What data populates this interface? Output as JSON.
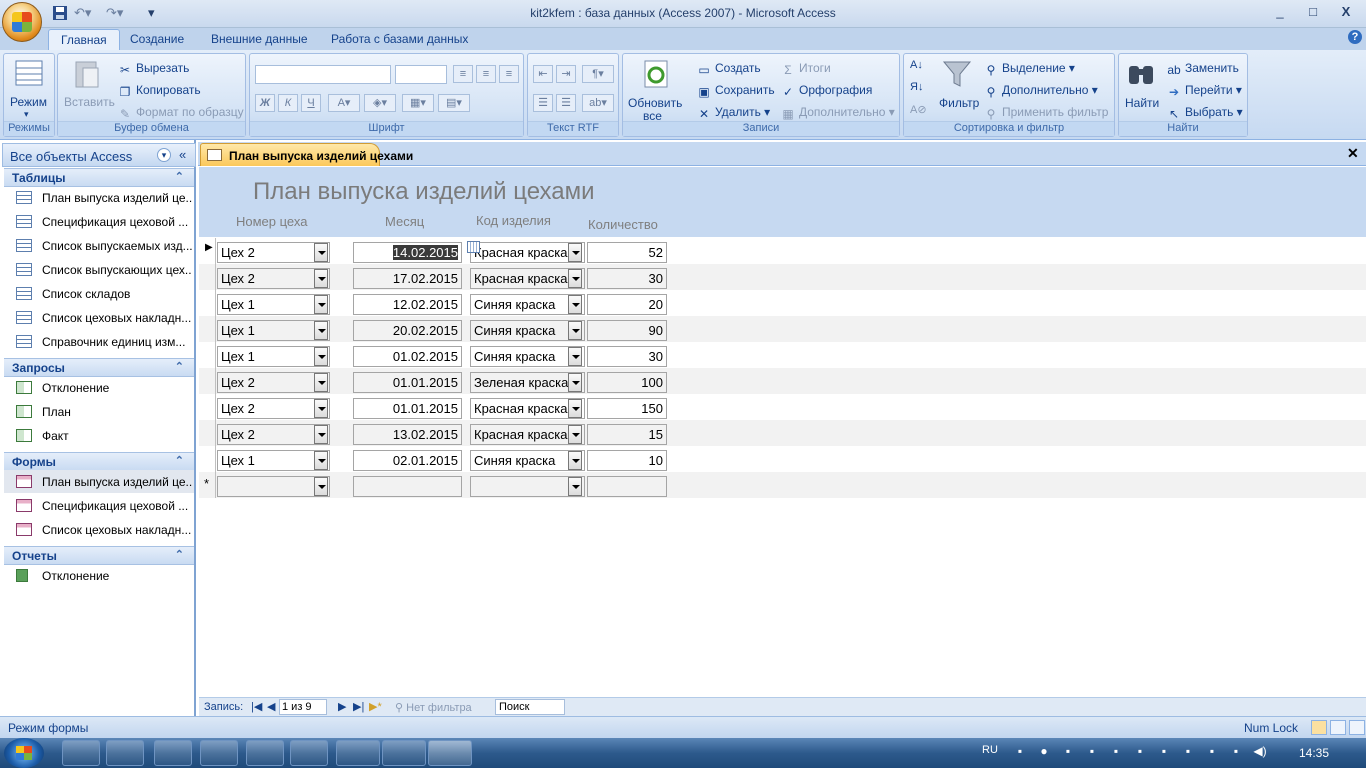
{
  "window": {
    "title": "kit2kfem : база данных (Access 2007) - Microsoft Access",
    "minimize": "_",
    "maximize": "□",
    "close": "X",
    "help": "?"
  },
  "ribbon_tabs": [
    "Главная",
    "Создание",
    "Внешние данные",
    "Работа с базами данных"
  ],
  "ribbon": {
    "modes": {
      "button": "Режим",
      "group": "Режимы"
    },
    "clipboard": {
      "paste": "Вставить",
      "cut": "Вырезать",
      "copy": "Копировать",
      "format_painter": "Формат по образцу",
      "group": "Буфер обмена"
    },
    "font": {
      "bold": "Ж",
      "italic": "К",
      "underline": "Ч",
      "group": "Шрифт"
    },
    "rtf": {
      "group": "Текст RTF"
    },
    "records": {
      "refresh": "Обновить",
      "refresh_sub": "все",
      "new": "Создать",
      "save": "Сохранить",
      "delete": "Удалить",
      "totals": "Итоги",
      "spelling": "Орфография",
      "more": "Дополнительно",
      "group": "Записи"
    },
    "sort_filter": {
      "filter": "Фильтр",
      "selection": "Выделение",
      "advanced": "Дополнительно",
      "toggle_filter": "Применить фильтр",
      "group": "Сортировка и фильтр"
    },
    "find": {
      "find": "Найти",
      "replace": "Заменить",
      "goto": "Перейти",
      "select": "Выбрать",
      "group": "Найти"
    }
  },
  "nav": {
    "title": "Все объекты Access",
    "sections": [
      {
        "label": "Таблицы",
        "items": [
          "План выпуска изделий це...",
          "Спецификация цеховой ...",
          "Список выпускаемых изд...",
          "Список выпускающих цех...",
          "Список складов",
          "Список цеховых накладн...",
          "Справочник единиц изм..."
        ]
      },
      {
        "label": "Запросы",
        "items": [
          "Отклонение",
          "План",
          "Факт"
        ]
      },
      {
        "label": "Формы",
        "items": [
          "План выпуска изделий це...",
          "Спецификация цеховой ...",
          "Список цеховых накладн..."
        ]
      },
      {
        "label": "Отчеты",
        "items": [
          "Отклонение"
        ]
      }
    ]
  },
  "document": {
    "tab_label": "План выпуска изделий цехами",
    "form_title": "План выпуска изделий цехами",
    "columns": [
      "Номер цеха",
      "Месяц",
      "Код изделия",
      "Количество"
    ],
    "rows": [
      {
        "shop": "Цех 2",
        "month": "14.02.2015",
        "product": "Красная краска",
        "qty": "52"
      },
      {
        "shop": "Цех 2",
        "month": "17.02.2015",
        "product": "Красная краска",
        "qty": "30"
      },
      {
        "shop": "Цех 1",
        "month": "12.02.2015",
        "product": "Синяя краска",
        "qty": "20"
      },
      {
        "shop": "Цех 1",
        "month": "20.02.2015",
        "product": "Синяя краска",
        "qty": "90"
      },
      {
        "shop": "Цех 1",
        "month": "01.02.2015",
        "product": "Синяя краска",
        "qty": "30"
      },
      {
        "shop": "Цех 2",
        "month": "01.01.2015",
        "product": "Зеленая краска",
        "qty": "100"
      },
      {
        "shop": "Цех 2",
        "month": "01.01.2015",
        "product": "Красная краска",
        "qty": "150"
      },
      {
        "shop": "Цех 2",
        "month": "13.02.2015",
        "product": "Красная краска",
        "qty": "15"
      },
      {
        "shop": "Цех 1",
        "month": "02.01.2015",
        "product": "Синяя краска",
        "qty": "10"
      }
    ],
    "new_row_marker": "*"
  },
  "record_nav": {
    "label": "Запись:",
    "position": "1 из 9",
    "filter": "Нет фильтра",
    "search_placeholder": "Поиск"
  },
  "status": {
    "mode": "Режим формы",
    "num_lock": "Num Lock"
  },
  "taskbar": {
    "lang": "RU",
    "time": "14:35"
  },
  "colors": {
    "ribbon": "#c6d9f1",
    "active_tab": "#fbc85b",
    "taskbar": "#2d5a8c"
  }
}
